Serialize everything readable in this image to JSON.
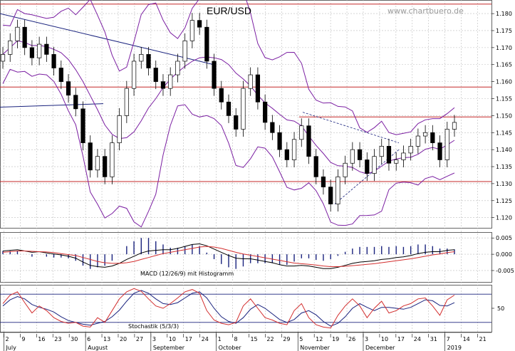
{
  "header": {
    "title": "EUR/USD",
    "watermark": "www.chartbuero.de"
  },
  "colors": {
    "price": "#000000",
    "bollinger": "#7b1fa2",
    "resistance": "#c62828",
    "trend": "#1a237e",
    "macd_line": "#000000",
    "macd_signal": "#d32f2f",
    "macd_hist": "#1a237e",
    "stoch_k": "#d32f2f",
    "stoch_d": "#1a237e",
    "grid": "#bdbdbd"
  },
  "chart_data": [
    {
      "type": "candlestick",
      "title": "EUR/USD",
      "ylim": [
        1.117,
        1.184
      ],
      "yticks": [
        1.12,
        1.125,
        1.13,
        1.135,
        1.14,
        1.145,
        1.15,
        1.155,
        1.16,
        1.165,
        1.17,
        1.175,
        1.18
      ],
      "grid": true,
      "x_ticks": [
        "2",
        "9",
        "16",
        "23",
        "30",
        "6",
        "13",
        "20",
        "27",
        "3",
        "10",
        "17",
        "24",
        "1",
        "8",
        "15",
        "22",
        "29",
        "5",
        "12",
        "19",
        "26",
        "3",
        "10",
        "17",
        "24",
        "31",
        "7",
        "14",
        "21"
      ],
      "months": [
        "July",
        "August",
        "September",
        "October",
        "November",
        "December",
        "2019"
      ],
      "horizontal_levels": [
        1.1828,
        1.1584,
        1.1496,
        1.1306
      ],
      "close": [
        1.168,
        1.172,
        1.176,
        1.17,
        1.167,
        1.171,
        1.168,
        1.164,
        1.16,
        1.156,
        1.152,
        1.142,
        1.134,
        1.138,
        1.132,
        1.142,
        1.15,
        1.158,
        1.166,
        1.168,
        1.164,
        1.16,
        1.158,
        1.162,
        1.166,
        1.172,
        1.178,
        1.176,
        1.166,
        1.158,
        1.154,
        1.15,
        1.146,
        1.158,
        1.162,
        1.154,
        1.148,
        1.145,
        1.14,
        1.137,
        1.143,
        1.147,
        1.138,
        1.132,
        1.129,
        1.124,
        1.132,
        1.136,
        1.14,
        1.137,
        1.133,
        1.138,
        1.141,
        1.136,
        1.137,
        1.139,
        1.141,
        1.144,
        1.145,
        1.142,
        1.137,
        1.146,
        1.148
      ]
    },
    {
      "type": "line",
      "label": "MACD (12/26/9) mit Histogramm",
      "yticks": [
        0.005,
        0.0,
        -0.005
      ],
      "ylim": [
        -0.0085,
        0.0068
      ],
      "series": [
        {
          "values": [
            0.001,
            0.0012,
            0.0014,
            0.001,
            0.0006,
            0.0008,
            0.0004,
            0.0001,
            -0.0002,
            -0.0006,
            -0.0012,
            -0.0024,
            -0.0034,
            -0.0038,
            -0.004,
            -0.0036,
            -0.0028,
            -0.0016,
            -0.0006,
            0.0004,
            0.001,
            0.0012,
            0.0014,
            0.0014,
            0.0018,
            0.0024,
            0.003,
            0.0032,
            0.0026,
            0.0016,
            0.0006,
            -0.0004,
            -0.0012,
            -0.0014,
            -0.0014,
            -0.0018,
            -0.0022,
            -0.0026,
            -0.0032,
            -0.0036,
            -0.0036,
            -0.0034,
            -0.0036,
            -0.004,
            -0.0044,
            -0.0044,
            -0.004,
            -0.0034,
            -0.0028,
            -0.0024,
            -0.0022,
            -0.002,
            -0.0016,
            -0.0014,
            -0.001,
            -0.0008,
            -0.0004,
            0.0002,
            0.0006,
            0.0008,
            0.0008,
            0.0012,
            0.0014
          ]
        },
        {
          "values": [
            0.0006,
            0.0008,
            0.001,
            0.001,
            0.0009,
            0.0008,
            0.0007,
            0.0005,
            0.0002,
            -0.0001,
            -0.0004,
            -0.001,
            -0.0016,
            -0.0022,
            -0.0026,
            -0.0028,
            -0.0028,
            -0.0026,
            -0.0022,
            -0.0016,
            -0.001,
            -0.0004,
            0.0002,
            0.0006,
            0.001,
            0.0014,
            0.0018,
            0.0022,
            0.0024,
            0.0022,
            0.0018,
            0.0012,
            0.0006,
            0.0001,
            -0.0003,
            -0.0007,
            -0.0011,
            -0.0015,
            -0.0019,
            -0.0023,
            -0.0027,
            -0.0029,
            -0.0031,
            -0.0033,
            -0.0036,
            -0.0038,
            -0.0038,
            -0.0037,
            -0.0035,
            -0.0033,
            -0.0031,
            -0.0029,
            -0.0026,
            -0.0023,
            -0.002,
            -0.0017,
            -0.0014,
            -0.001,
            -0.0006,
            -0.0002,
            0.0001,
            0.0005,
            0.0008
          ]
        }
      ]
    },
    {
      "type": "line",
      "label": "Stochastik (5/3/3)",
      "yticks": [
        50
      ],
      "ylim": [
        0,
        100
      ],
      "levels": [
        80,
        20
      ],
      "series": [
        {
          "values": [
            60,
            78,
            85,
            62,
            40,
            55,
            45,
            30,
            22,
            18,
            20,
            12,
            10,
            30,
            20,
            45,
            70,
            85,
            92,
            86,
            70,
            55,
            50,
            60,
            72,
            85,
            90,
            82,
            45,
            25,
            18,
            15,
            20,
            55,
            70,
            50,
            30,
            25,
            18,
            15,
            45,
            60,
            30,
            15,
            10,
            8,
            35,
            55,
            70,
            55,
            30,
            50,
            65,
            40,
            45,
            55,
            60,
            70,
            72,
            55,
            35,
            68,
            78
          ]
        },
        {
          "values": [
            55,
            68,
            75,
            70,
            58,
            52,
            48,
            42,
            32,
            24,
            20,
            16,
            14,
            18,
            22,
            32,
            46,
            65,
            82,
            88,
            82,
            70,
            60,
            58,
            62,
            72,
            82,
            85,
            72,
            50,
            32,
            22,
            18,
            30,
            48,
            58,
            50,
            38,
            26,
            20,
            26,
            40,
            45,
            36,
            22,
            12,
            18,
            32,
            50,
            60,
            52,
            45,
            52,
            52,
            50,
            48,
            52,
            60,
            68,
            66,
            56,
            55,
            62
          ]
        }
      ]
    }
  ],
  "panels": {
    "macd_label": "MACD (12/26/9) mit Histogramm",
    "stoch_label": "Stochastik (5/3/3)"
  }
}
